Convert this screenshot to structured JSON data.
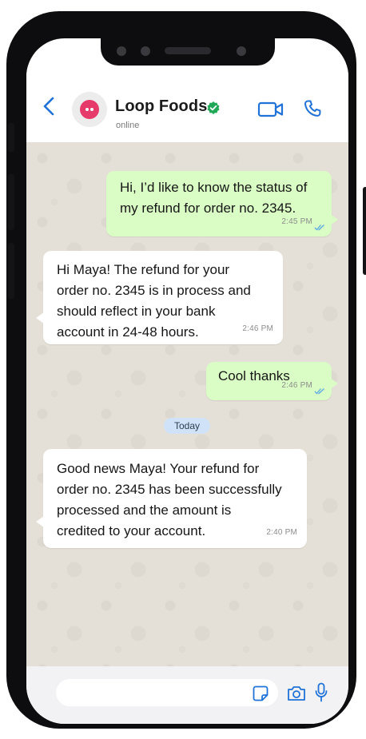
{
  "header": {
    "contact_name": "Loop Foods",
    "status": "online"
  },
  "messages": [
    {
      "direction": "outgoing",
      "text": "Hi, I’d like to know the status of\nmy refund for order no. 2345.",
      "time": "2:45 PM",
      "ticks": "read"
    },
    {
      "direction": "incoming",
      "text": "Hi Maya! The refund for your\norder no. 2345 is in process and\nshould reflect in your bank\naccount in 24-48 hours.",
      "time": "2:46 PM"
    },
    {
      "direction": "outgoing",
      "text": "Cool thanks",
      "time": "2:46 PM",
      "ticks": "read"
    },
    {
      "direction": "incoming",
      "text": "Good news Maya! Your refund for\norder no. 2345 has been successfully\nprocessed and the amount is\ncredited to your account.",
      "time": "2:40 PM"
    }
  ],
  "date_separator": "Today",
  "composer": {
    "placeholder": ""
  },
  "icons": {
    "back": "chevron-left-icon",
    "verified": "verified-badge-icon",
    "video": "video-call-icon",
    "call": "phone-call-icon",
    "sticker": "sticker-icon",
    "camera": "camera-icon",
    "mic": "microphone-icon"
  },
  "colors": {
    "accent": "#1f72d8",
    "verified": "#1fa855",
    "outgoing_bubble": "#d9fdc4",
    "incoming_bubble": "#ffffff",
    "chat_background": "#e5e0d7",
    "avatar_brand": "#e63a6a",
    "date_pill": "#cfe2f7",
    "read_ticks": "#5aa9e6"
  }
}
